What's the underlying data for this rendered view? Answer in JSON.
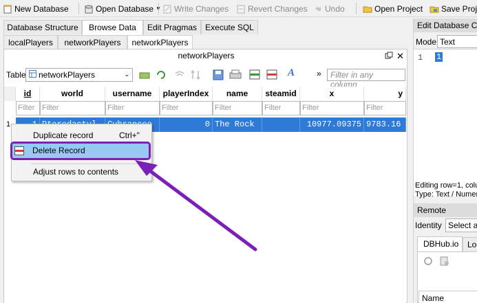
{
  "toolbar": {
    "new_database": "New Database",
    "open_database": "Open Database",
    "write_changes": "Write Changes",
    "revert_changes": "Revert Changes",
    "undo": "Undo",
    "open_project": "Open Project",
    "save_project": "Save Proje"
  },
  "main_tabs": [
    {
      "label": "Database Structure"
    },
    {
      "label": "Browse Data"
    },
    {
      "label": "Edit Pragmas"
    },
    {
      "label": "Execute SQL"
    }
  ],
  "sub_tabs": [
    {
      "label": "localPlayers"
    },
    {
      "label": "networkPlayers"
    },
    {
      "label": "networkPlayers"
    }
  ],
  "pane": {
    "title": "networkPlayers",
    "float_icon": "restore-icon",
    "close_icon": "close-icon"
  },
  "table_bar": {
    "label": "Table:",
    "selected_table": "networkPlayers",
    "more_glyph": "»",
    "filter_placeholder": "Filter in any column"
  },
  "grid": {
    "columns": [
      "id",
      "world",
      "username",
      "playerIndex",
      "name",
      "steamid",
      "x",
      "y"
    ],
    "filter_placeholder": "Filter",
    "row_number": "1",
    "row": [
      "1",
      "Pterodactyl",
      "Cybrancee",
      "0",
      "The Rock",
      "",
      "10977.09375",
      "9783.16"
    ]
  },
  "context_menu": {
    "items": [
      {
        "label": "Duplicate record",
        "shortcut": "Ctrl+\""
      },
      {
        "label": "Delete Record",
        "shortcut": ""
      },
      {
        "label": "Adjust rows to contents",
        "shortcut": ""
      }
    ]
  },
  "highlight_color": "#7a1fb8",
  "selection_color": "#2f7ad6",
  "edit_cell": {
    "title": "Edit Database Ce",
    "mode_label": "Mode:",
    "mode_value": "Text",
    "line_number": "1",
    "value": "1",
    "status_line1": "Editing row=1, colu",
    "status_line2": "Type: Text / Numer"
  },
  "remote": {
    "title": "Remote",
    "identity_label": "Identity",
    "identity_value": "Select an",
    "tabs": [
      {
        "label": "DBHub.io"
      },
      {
        "label": "Lo"
      }
    ],
    "column_header": "Name"
  }
}
